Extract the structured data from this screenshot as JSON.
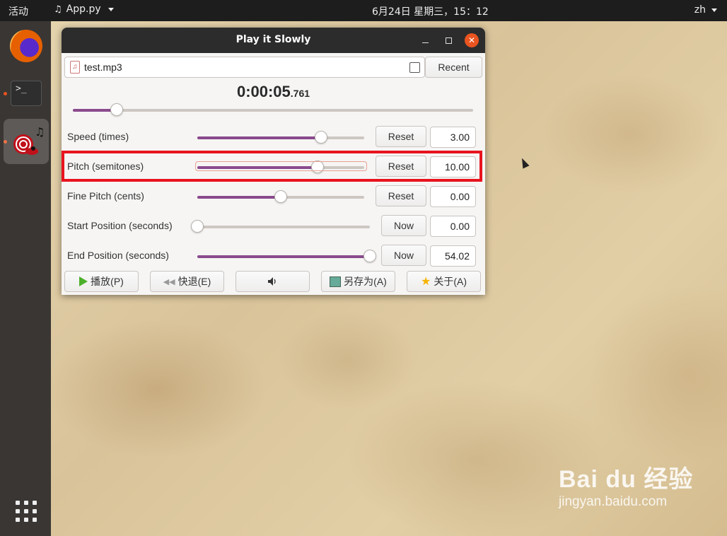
{
  "topbar": {
    "activities": "活动",
    "app_menu": "App.py",
    "clock": "6月24日 星期三，15：12",
    "language": "zh"
  },
  "dock": {
    "items": [
      "firefox",
      "terminal",
      "play-it-slowly"
    ],
    "terminal_prompt": ">_"
  },
  "window": {
    "title": "Play it Slowly",
    "file": {
      "name": "test.mp3",
      "recent_label": "Recent"
    },
    "time": {
      "main": "0:00:05",
      "ms": ".761"
    },
    "position_fraction": 0.11,
    "rows": [
      {
        "label": "Speed (times)",
        "button": "Reset",
        "value": "3.00",
        "fraction": 0.74
      },
      {
        "label": "Pitch (semitones)",
        "button": "Reset",
        "value": "10.00",
        "fraction": 0.72
      },
      {
        "label": "Fine Pitch (cents)",
        "button": "Reset",
        "value": "0.00",
        "fraction": 0.5
      },
      {
        "label": "Start Position (seconds)",
        "button": "Now",
        "value": "0.00",
        "fraction": 0.0
      },
      {
        "label": "End Position (seconds)",
        "button": "Now",
        "value": "54.02",
        "fraction": 1.0
      }
    ],
    "bottom_buttons": {
      "play": "播放(P)",
      "rewind": "快退(E)",
      "save": "另存为(A)",
      "about": "关于(A)"
    }
  },
  "watermark": {
    "brand": "Bai du 经验",
    "url": "jingyan.baidu.com"
  },
  "colors": {
    "accent": "#8a4a8d",
    "highlight": "#e8141e",
    "close": "#e95420",
    "topbar": "#1d1d1d"
  }
}
